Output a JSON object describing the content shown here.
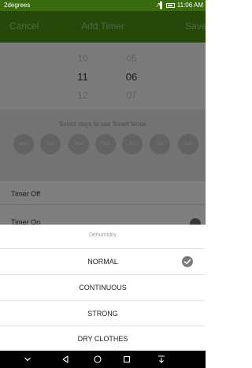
{
  "status_bar": {
    "carrier": "2degrees",
    "time": "11:06 AM",
    "battery_icon": "battery-icon",
    "signal_icon": "signal-icon"
  },
  "header": {
    "cancel_label": "Cancel",
    "title": "Add Timer",
    "save_label": "Save"
  },
  "time_picker": {
    "hours": [
      "10",
      "11",
      "12"
    ],
    "minutes": [
      "05",
      "06",
      "07"
    ],
    "selected_hour": "11",
    "selected_minute": "06"
  },
  "days": {
    "label": "Select days to use Smart Mode",
    "items": [
      "Mon",
      "Tue",
      "Wed",
      "Thur",
      "Fri",
      "Sat",
      "Sun"
    ]
  },
  "timer_rows": {
    "off_label": "Timer Off",
    "on_label": "Timer On"
  },
  "sheet": {
    "title": "Dehumidity",
    "options": [
      "NORMAL",
      "CONTINUOUS",
      "STRONG",
      "DRY CLOTHES"
    ],
    "selected": "NORMAL"
  },
  "nav_bar": {
    "icons": [
      "chevron-down-icon",
      "back-icon",
      "home-icon",
      "recents-icon",
      "notification-pull-icon"
    ]
  },
  "colors": {
    "header_green": "#4a8a16",
    "status_green": "#3a6b10",
    "header_text": "#9dc47a"
  }
}
